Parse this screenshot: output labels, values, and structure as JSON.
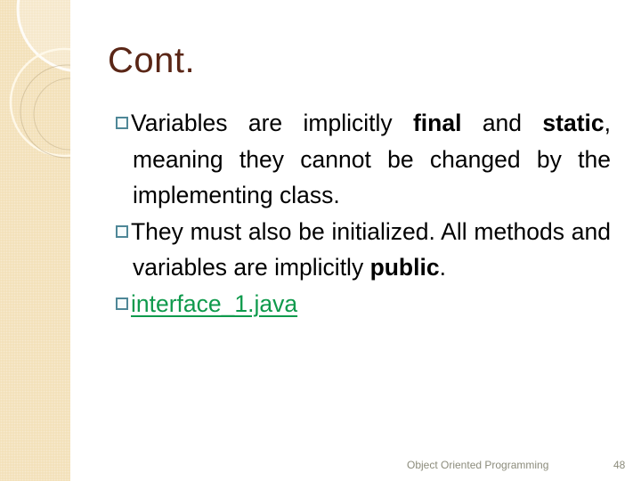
{
  "slide": {
    "title": "Cont.",
    "bullets": [
      {
        "segments": [
          {
            "text": "Variables are implicitly ",
            "bold": false
          },
          {
            "text": "final",
            "bold": true
          },
          {
            "text": " and ",
            "bold": false
          },
          {
            "text": "static",
            "bold": true
          },
          {
            "text": ", meaning they cannot be changed by the implementing class.",
            "bold": false
          }
        ]
      },
      {
        "segments": [
          {
            "text": "They must also be initialized. All methods and variables are implicitly ",
            "bold": false
          },
          {
            "text": "public",
            "bold": true
          },
          {
            "text": ".",
            "bold": false
          }
        ]
      },
      {
        "link_text": "interface_1.java"
      }
    ],
    "colors": {
      "title": "#5a2616",
      "bullet_border": "#4e8797",
      "link": "#0f9a4c",
      "sidebar": "#f2dfb6",
      "footer": "#8c8c7c"
    }
  },
  "footer": {
    "course_title": "Object Oriented Programming",
    "page_number": "48"
  }
}
